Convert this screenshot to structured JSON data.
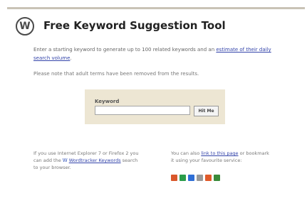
{
  "header": {
    "logo_glyph": "W",
    "title": "Free Keyword Suggestion Tool"
  },
  "intro": {
    "text": "Enter a starting keyword to generate up to 100 related keywords and an ",
    "link": "estimate of their daily search volume",
    "end": "."
  },
  "note": "Please note that adult terms have been removed from the results.",
  "form": {
    "label": "Keyword",
    "value": "",
    "button": "Hit Me"
  },
  "bottom_left": {
    "pre": "If you use Internet Explorer 7 or Firefox 2 you can add the ",
    "link": "Wordtracker Keywords",
    "post": " search to your browser."
  },
  "bottom_right": {
    "pre": "You can also ",
    "link": "link to this page",
    "post": " or bookmark it using your favourite service:"
  },
  "social_icons": [
    {
      "name": "digg-icon",
      "color": "#d9572b"
    },
    {
      "name": "delicious-icon",
      "color": "#2a9d4a"
    },
    {
      "name": "technorati-icon",
      "color": "#2f6fd6"
    },
    {
      "name": "stumbleupon-icon",
      "color": "#9a9a9a"
    },
    {
      "name": "reddit-icon",
      "color": "#e05a2a"
    },
    {
      "name": "furl-icon",
      "color": "#3a8a3a"
    }
  ]
}
